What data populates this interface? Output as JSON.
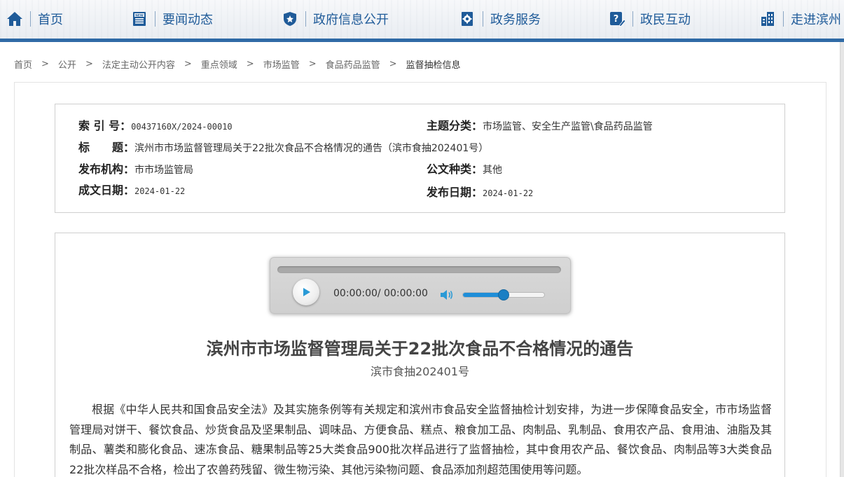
{
  "nav": {
    "items": [
      {
        "label": "首页",
        "icon": "home-icon"
      },
      {
        "label": "要闻动态",
        "icon": "news-icon"
      },
      {
        "label": "政府信息公开",
        "icon": "shield-icon"
      },
      {
        "label": "政务服务",
        "icon": "gear-doc-icon"
      },
      {
        "label": "政民互动",
        "icon": "question-edit-icon"
      },
      {
        "label": "走进滨州",
        "icon": "building-icon"
      }
    ],
    "accent": "#2f6aa6",
    "icon_color": "#1f5b99"
  },
  "breadcrumb": {
    "items": [
      "首页",
      "公开",
      "法定主动公开内容",
      "重点领域",
      "市场监管",
      "食品药品监管",
      "监督抽检信息"
    ],
    "separator": ">"
  },
  "meta": {
    "index_label": "索 引 号：",
    "index_value": "00437160X/2024-00010",
    "category_label": "主题分类：",
    "category_value": "市场监管、安全生产监管\\食品药品监管",
    "title_label": "标　　题：",
    "title_value": "滨州市市场监督管理局关于22批次食品不合格情况的通告（滨市食抽202401号）",
    "issuer_label": "发布机构：",
    "issuer_value": "市市场监管局",
    "doctype_label": "公文种类：",
    "doctype_value": "其他",
    "written_label": "成文日期：",
    "written_value": "2024-01-22",
    "published_label": "发布日期：",
    "published_value": "2024-01-22"
  },
  "player": {
    "time": "00:00:00/ 00:00:00",
    "volume": 0.5
  },
  "document": {
    "title": "滨州市市场监督管理局关于22批次食品不合格情况的通告",
    "number": "滨市食抽202401号",
    "paragraph": "根据《中华人民共和国食品安全法》及其实施条例等有关规定和滨州市食品安全监督抽检计划安排，为进一步保障食品安全，市市场监督管理局对饼干、餐饮食品、炒货食品及坚果制品、调味品、方便食品、糕点、粮食加工品、肉制品、乳制品、食用农产品、食用油、油脂及其制品、薯类和膨化食品、速冻食品、糖果制品等25大类食品900批次样品进行了监督抽检，其中食用农产品、餐饮食品、肉制品等3大类食品22批次样品不合格，检出了农兽药残留、微生物污染、其他污染物问题、食品添加剂超范围使用等问题。"
  }
}
